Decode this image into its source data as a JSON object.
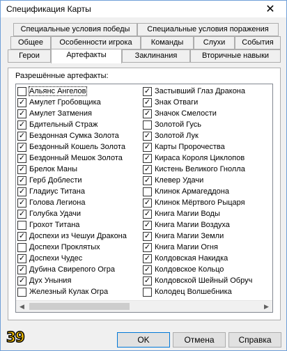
{
  "window": {
    "title": "Спецификация Карты",
    "close_glyph": "✕"
  },
  "tabs": {
    "row1": [
      "Специальные условия победы",
      "Специальные условия поражения"
    ],
    "row2": [
      "Общее",
      "Особенности игрока",
      "Команды",
      "Слухи",
      "События"
    ],
    "row3": [
      "Герои",
      "Артефакты",
      "Заклинания",
      "Вторичные навыки"
    ],
    "active": "Артефакты"
  },
  "panel": {
    "label": "Разрешённые артефакты:"
  },
  "artifacts": {
    "left": [
      {
        "label": "Альянс Ангелов",
        "checked": false,
        "focused": true
      },
      {
        "label": "Амулет Гробовщика",
        "checked": true
      },
      {
        "label": "Амулет Затмения",
        "checked": true
      },
      {
        "label": "Бдительный Страж",
        "checked": true
      },
      {
        "label": "Бездонная Сумка Золота",
        "checked": true
      },
      {
        "label": "Бездонный Кошель Золота",
        "checked": true
      },
      {
        "label": "Бездонный Мешок Золота",
        "checked": true
      },
      {
        "label": "Брелок Маны",
        "checked": true
      },
      {
        "label": "Герб Доблести",
        "checked": true
      },
      {
        "label": "Гладиус Титана",
        "checked": true
      },
      {
        "label": "Голова Легиона",
        "checked": true
      },
      {
        "label": "Голубка Удачи",
        "checked": true
      },
      {
        "label": "Грохот Титана",
        "checked": false
      },
      {
        "label": "Доспехи из Чешуи Дракона",
        "checked": true
      },
      {
        "label": "Доспехи Проклятых",
        "checked": false
      },
      {
        "label": "Доспехи Чудес",
        "checked": true
      },
      {
        "label": "Дубина Свирепого Огра",
        "checked": true
      },
      {
        "label": "Дух Уныния",
        "checked": true
      },
      {
        "label": "Железный Кулак Огра",
        "checked": false
      }
    ],
    "right": [
      {
        "label": "Застывший Глаз Дракона",
        "checked": true
      },
      {
        "label": "Знак Отваги",
        "checked": true
      },
      {
        "label": "Значок Смелости",
        "checked": true
      },
      {
        "label": "Золотой Гусь",
        "checked": false
      },
      {
        "label": "Золотой Лук",
        "checked": true
      },
      {
        "label": "Карты Пророчества",
        "checked": true
      },
      {
        "label": "Кираса Короля Циклопов",
        "checked": true
      },
      {
        "label": "Кистень Великого Гнолла",
        "checked": true
      },
      {
        "label": "Клевер Удачи",
        "checked": true
      },
      {
        "label": "Клинок Армагеддона",
        "checked": false
      },
      {
        "label": "Клинок Мёртвого Рыцаря",
        "checked": true
      },
      {
        "label": "Книга Магии Воды",
        "checked": true
      },
      {
        "label": "Книга Магии Воздуха",
        "checked": true
      },
      {
        "label": "Книга Магии Земли",
        "checked": true
      },
      {
        "label": "Книга Магии Огня",
        "checked": true
      },
      {
        "label": "Колдовская Накидка",
        "checked": true
      },
      {
        "label": "Колдовское Кольцо",
        "checked": true
      },
      {
        "label": "Колдовской Шейный Обруч",
        "checked": true
      },
      {
        "label": "Колодец Волшебника",
        "checked": false
      }
    ]
  },
  "scrollbar": {
    "left_arrow": "◀",
    "right_arrow": "▶"
  },
  "buttons": {
    "ok": "OK",
    "cancel": "Отмена",
    "help": "Справка"
  },
  "badge": "39"
}
